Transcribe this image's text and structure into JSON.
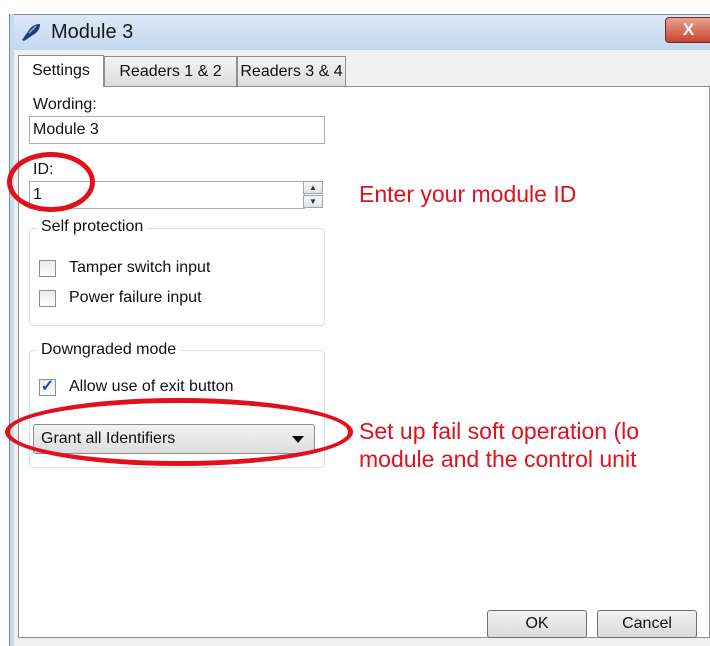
{
  "window": {
    "title": "Module 3",
    "close_label": "X"
  },
  "tabs": [
    "Settings",
    "Readers 1 & 2",
    "Readers 3 & 4"
  ],
  "settings": {
    "wording_label": "Wording:",
    "wording_value": "Module 3",
    "id_label": "ID:",
    "id_value": "1",
    "self_protection": {
      "title": "Self protection",
      "tamper_label": "Tamper switch input",
      "tamper_checked": false,
      "power_label": "Power failure input",
      "power_checked": false
    },
    "downgraded_mode": {
      "title": "Downgraded mode",
      "exit_label": "Allow use of exit button",
      "exit_checked": true,
      "mode_value": "Grant all Identifiers"
    }
  },
  "buttons": {
    "ok": "OK",
    "cancel": "Cancel"
  },
  "annotations": {
    "id_note": "Enter your module ID",
    "fail_soft_line1": "Set up fail soft operation (lo",
    "fail_soft_line2": "module and the control unit"
  },
  "colors": {
    "annotation": "#e0101c",
    "titlebar": "#c3d7ee",
    "checkmark": "#1c4bbf"
  }
}
